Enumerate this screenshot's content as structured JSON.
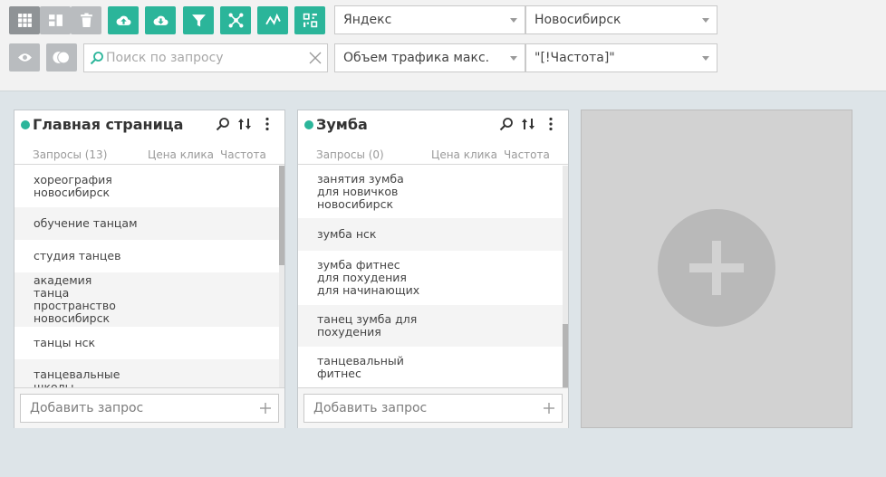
{
  "toolbar": {
    "view_buttons": [
      {
        "icon": "grid-icon",
        "active": true
      },
      {
        "icon": "columns-icon",
        "active": false
      },
      {
        "icon": "trash-icon",
        "active": false
      }
    ],
    "action_buttons": [
      {
        "icon": "cloud-upload-icon"
      },
      {
        "icon": "cloud-download-icon"
      },
      {
        "icon": "filter-icon"
      },
      {
        "icon": "cluster-icon"
      },
      {
        "icon": "chart-line-icon"
      },
      {
        "icon": "qr-icon"
      }
    ],
    "row2_buttons": [
      {
        "icon": "eye-icon"
      },
      {
        "icon": "toggle-icon"
      }
    ],
    "search_placeholder": "Поиск по запросу",
    "search_engine": "Яндекс",
    "region": "Новосибирск",
    "sort_field": "Объем трафика макс.",
    "frequency_type": "\"[!Частота]\"",
    "accent_color": "#2bb59a"
  },
  "panels": [
    {
      "title": "Главная страница",
      "col_queries": "Запросы (13)",
      "col_price": "Цена клика",
      "col_freq": "Частота",
      "rows": [
        "хореография новосибирск",
        "обучение танцам",
        "студия танцев",
        "академия танца пространство новосибирск",
        "танцы нск",
        "танцевальные школы новосибирск"
      ],
      "add_placeholder": "Добавить запрос"
    },
    {
      "title": "Зумба",
      "col_queries": "Запросы (0)",
      "col_price": "Цена клика",
      "col_freq": "Частота",
      "rows": [
        "занятия зумба для новичков новосибирск",
        "зумба нск",
        "зумба фитнес для похудения для начинающих",
        "танец зумба для похудения",
        "танцевальный фитнес"
      ],
      "add_placeholder": "Добавить запрос"
    }
  ]
}
